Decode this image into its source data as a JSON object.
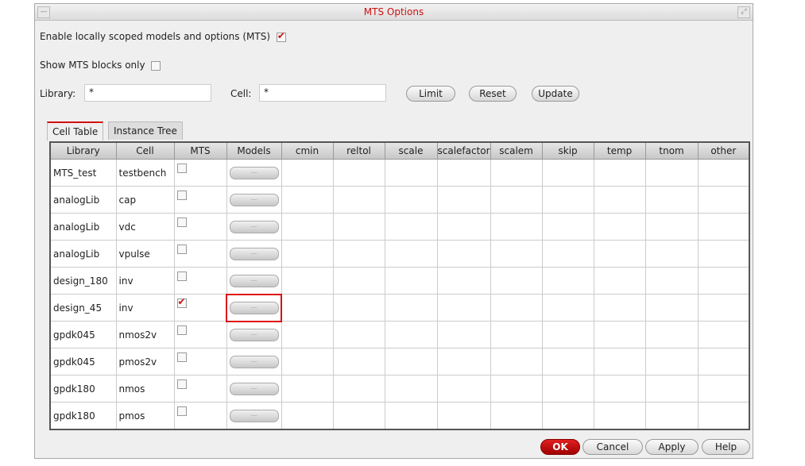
{
  "window": {
    "title": "MTS Options"
  },
  "options": {
    "enable_label": "Enable locally scoped models and options (MTS)",
    "enable_checked": true,
    "show_blocks_label": "Show MTS blocks only",
    "show_blocks_checked": false
  },
  "filters": {
    "library_label": "Library:",
    "library_value": "*",
    "cell_label": "Cell:",
    "cell_value": "*"
  },
  "buttons": {
    "limit": "Limit",
    "reset": "Reset",
    "update": "Update",
    "ok": "OK",
    "cancel": "Cancel",
    "apply": "Apply",
    "help": "Help"
  },
  "tabs": [
    "Cell Table",
    "Instance Tree"
  ],
  "table": {
    "columns": [
      "Library",
      "Cell",
      "MTS",
      "Models",
      "cmin",
      "reltol",
      "scale",
      "scalefactor",
      "scalem",
      "skip",
      "temp",
      "tnom",
      "other"
    ],
    "models_button": "...",
    "rows": [
      {
        "library": "MTS_test",
        "cell": "testbench",
        "mts": false
      },
      {
        "library": "analogLib",
        "cell": "cap",
        "mts": false
      },
      {
        "library": "analogLib",
        "cell": "vdc",
        "mts": false
      },
      {
        "library": "analogLib",
        "cell": "vpulse",
        "mts": false
      },
      {
        "library": "design_180",
        "cell": "inv",
        "mts": false
      },
      {
        "library": "design_45",
        "cell": "inv",
        "mts": true
      },
      {
        "library": "gpdk045",
        "cell": "nmos2v",
        "mts": false
      },
      {
        "library": "gpdk045",
        "cell": "pmos2v",
        "mts": false
      },
      {
        "library": "gpdk180",
        "cell": "nmos",
        "mts": false
      },
      {
        "library": "gpdk180",
        "cell": "pmos",
        "mts": false
      }
    ]
  }
}
